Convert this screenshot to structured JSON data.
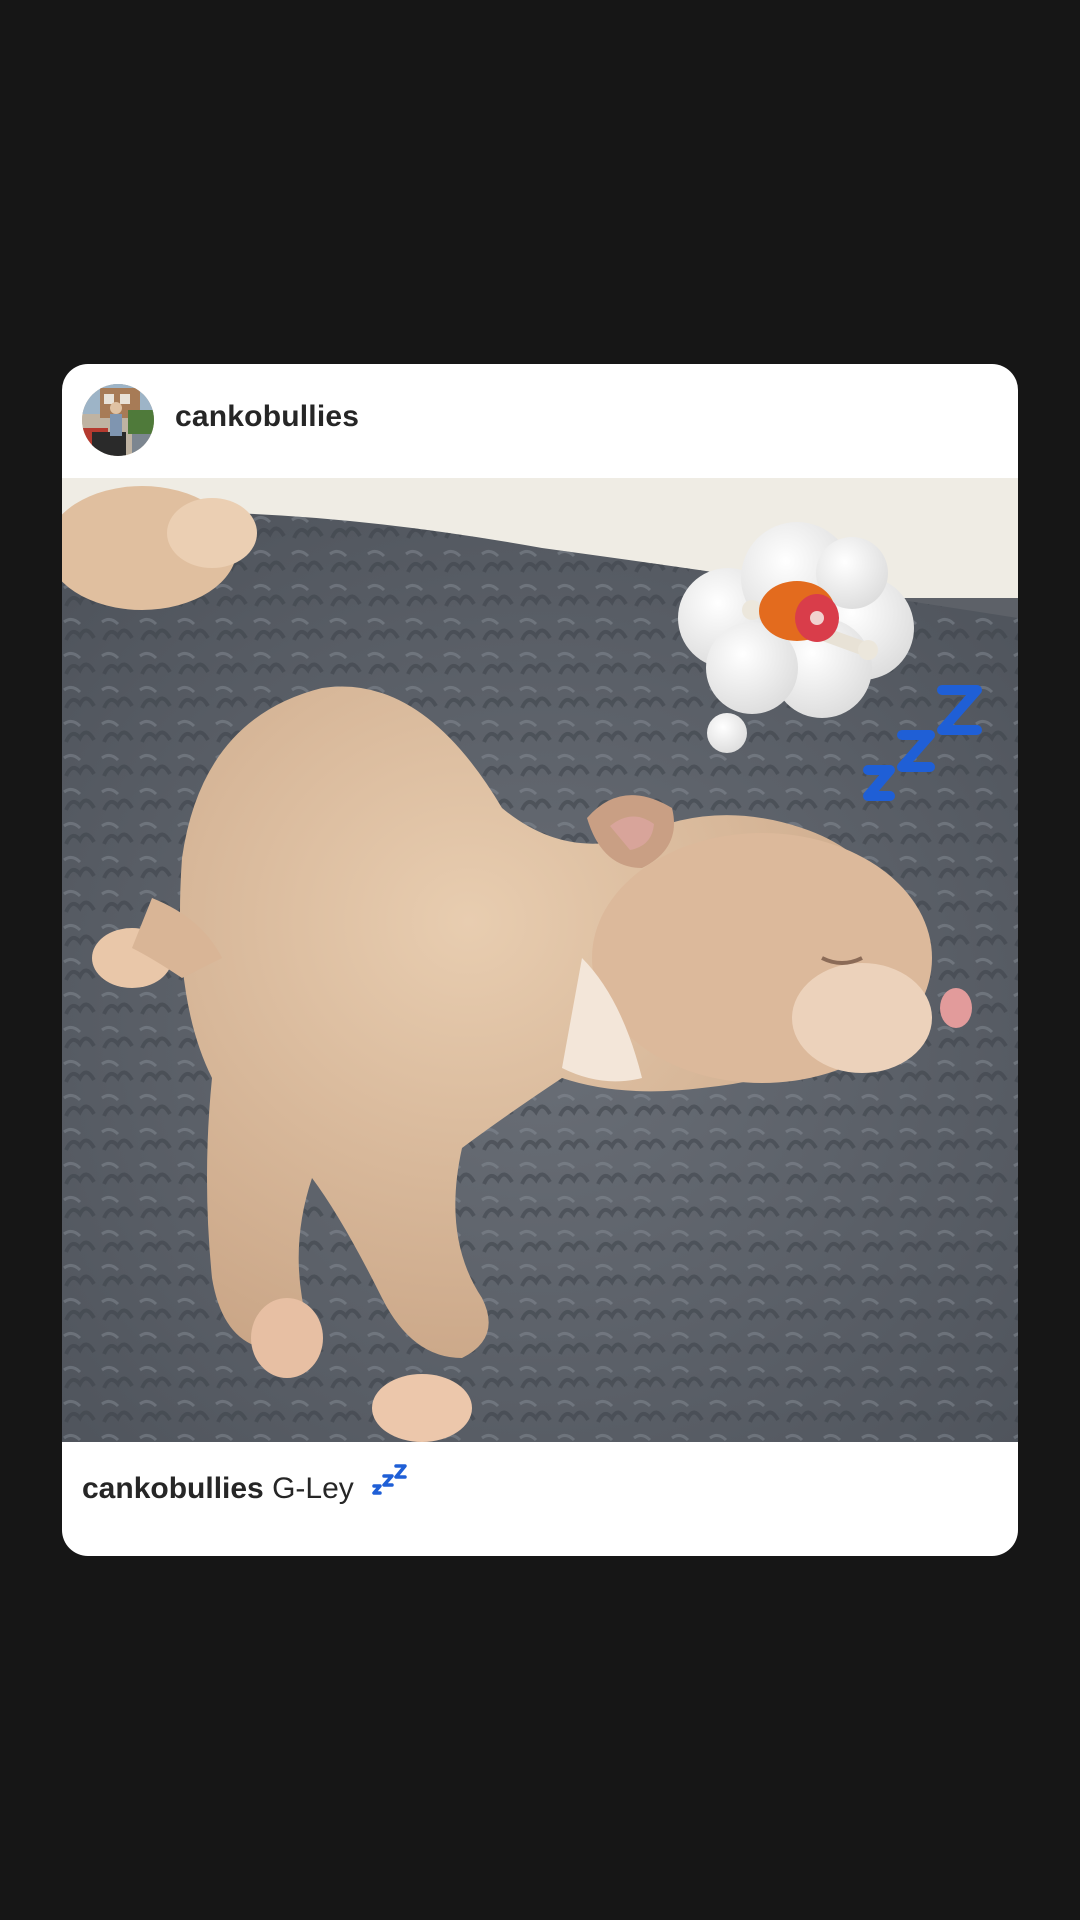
{
  "post": {
    "username": "cankobullies",
    "caption_user": "cankobullies",
    "caption_text": "G-Ley",
    "image": {
      "subject": "sleeping-puppy-photo",
      "stickers": [
        "thought-bubble-meat-icon",
        "zzz-icon"
      ]
    }
  },
  "colors": {
    "background": "#161616",
    "card": "#ffffff",
    "text": "#262626",
    "zzz_blue": "#1f5fd6"
  }
}
